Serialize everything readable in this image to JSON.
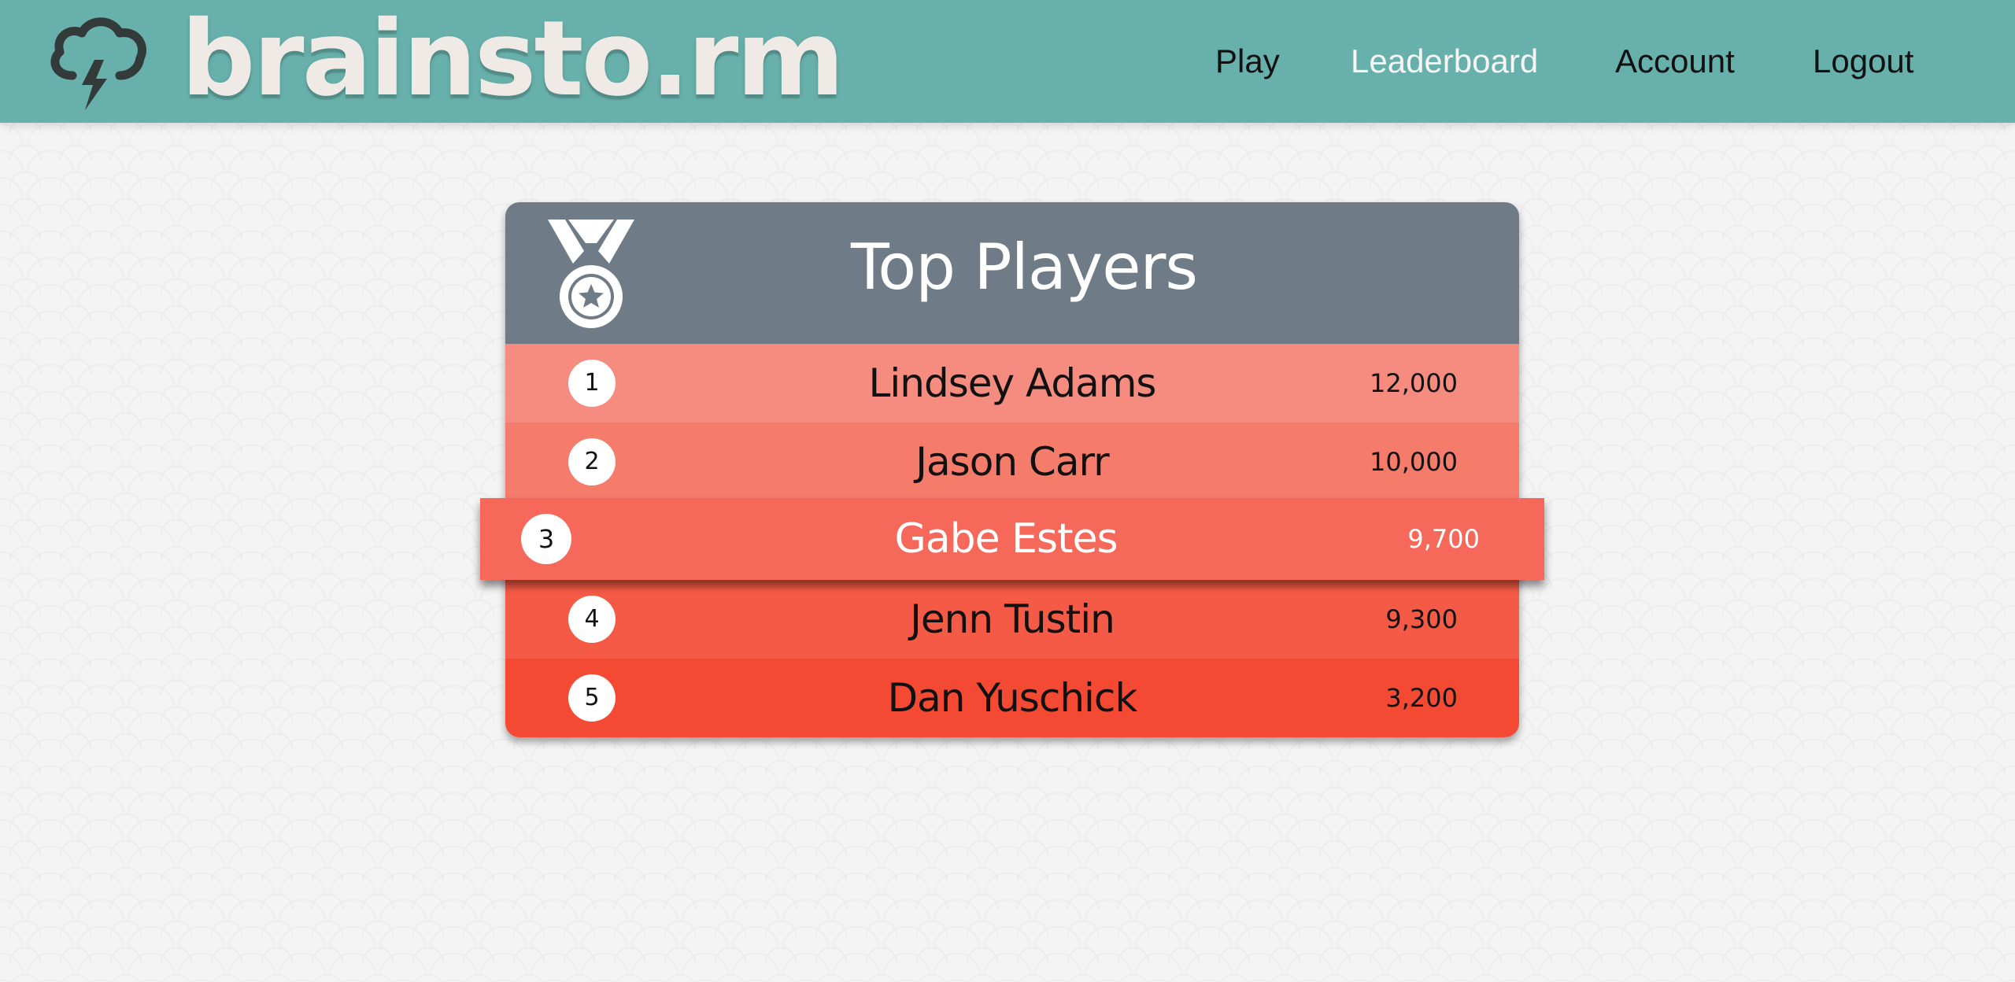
{
  "header": {
    "brand": "brainsto.rm",
    "logo_icon": "storm-cloud-lightning-icon",
    "bg_color": "#68b0ab",
    "nav": [
      {
        "label": "Play",
        "active": false
      },
      {
        "label": "Leaderboard",
        "active": true
      },
      {
        "label": "Account",
        "active": false
      },
      {
        "label": "Logout",
        "active": false
      }
    ]
  },
  "leaderboard": {
    "title": "Top Players",
    "icon": "medal-icon",
    "header_color": "#6f7b86",
    "highlighted_rank": "3",
    "rows": [
      {
        "rank": "1",
        "name": "Lindsey Adams",
        "score": "12,000",
        "color": "#f68c7f"
      },
      {
        "rank": "2",
        "name": "Jason Carr",
        "score": "10,000",
        "color": "#f57b6b"
      },
      {
        "rank": "3",
        "name": "Gabe Estes",
        "score": "9,700",
        "color": "#f5685a"
      },
      {
        "rank": "4",
        "name": "Jenn Tustin",
        "score": "9,300",
        "color": "#f55a46"
      },
      {
        "rank": "5",
        "name": "Dan Yuschick",
        "score": "3,200",
        "color": "#f44a33"
      }
    ]
  }
}
